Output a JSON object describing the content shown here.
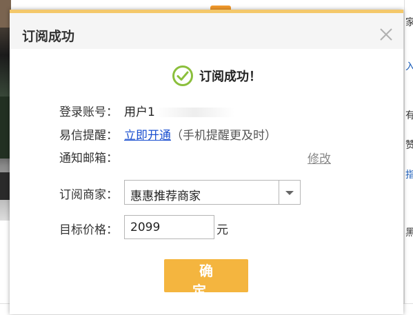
{
  "dialog": {
    "title": "订阅成功",
    "close_icon": "close-icon",
    "success_icon": "check-circle-icon",
    "success_message": "订阅成功！",
    "account_label": "登录账号：",
    "account_value": "用户1",
    "yixin_label": "易信提醒：",
    "yixin_link": "立即开通",
    "yixin_hint": "（手机提醒更及时）",
    "email_label": "通知邮箱：",
    "edit_link": "修改",
    "merchant_label": "订阅商家：",
    "merchant_selected": "惠惠推荐商家",
    "price_label": "目标价格：",
    "price_value": "2099",
    "price_unit": "元",
    "confirm_button": "确　定"
  },
  "background": {
    "right_fragments": [
      "家推",
      "入门",
      "有",
      "赞",
      "指",
      "黑"
    ]
  },
  "colors": {
    "accent": "#f4b53f",
    "success_green": "#8bbf3c",
    "link_blue": "#1a4fd0",
    "top_bar": "#f4c86a"
  }
}
